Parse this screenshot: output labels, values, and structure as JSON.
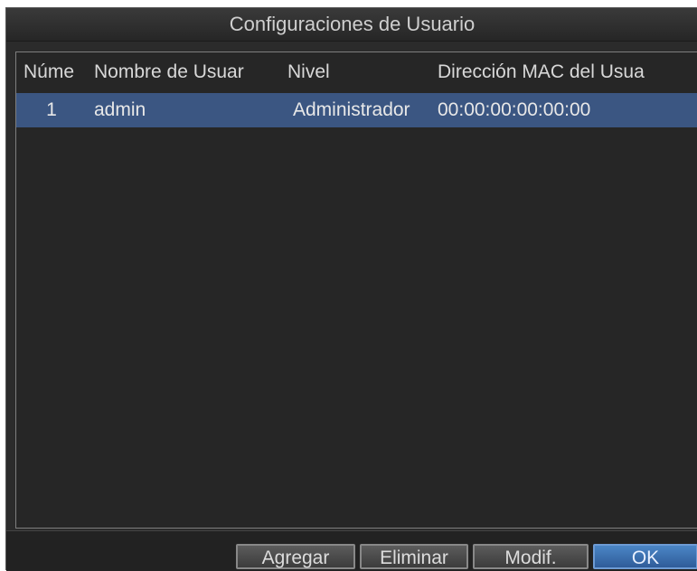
{
  "window": {
    "title": "Configuraciones de Usuario"
  },
  "table": {
    "columns": [
      "Núme",
      "Nombre de Usuar",
      "Nivel",
      "Dirección MAC del Usua"
    ],
    "rows": [
      {
        "num": "1",
        "name": "admin",
        "level": "Administrador",
        "mac": "00:00:00:00:00:00"
      }
    ]
  },
  "buttons": {
    "add": "Agregar",
    "delete": "Eliminar",
    "modify": "Modif.",
    "ok": "OK"
  },
  "colors": {
    "selected_row": "#3b5682",
    "ok_button": "#3f74b5"
  }
}
